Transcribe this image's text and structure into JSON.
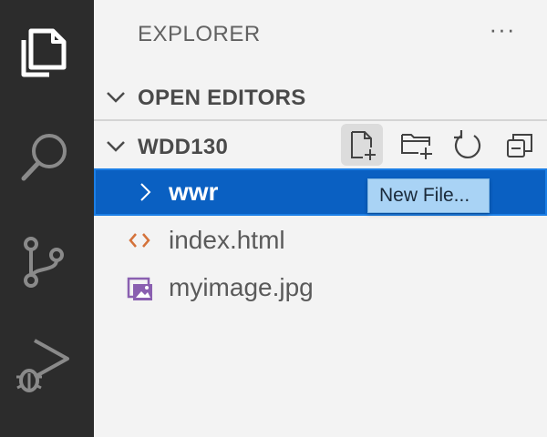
{
  "activity_bar": {
    "items": [
      {
        "icon": "files-icon"
      },
      {
        "icon": "search-icon"
      },
      {
        "icon": "source-control-icon"
      },
      {
        "icon": "run-debug-icon"
      }
    ]
  },
  "explorer": {
    "title": "EXPLORER",
    "more_label": "···",
    "open_editors_label": "OPEN EDITORS",
    "folder_label": "WDD130",
    "toolbar": [
      {
        "icon": "new-file-icon"
      },
      {
        "icon": "new-folder-icon"
      },
      {
        "icon": "refresh-icon"
      },
      {
        "icon": "collapse-all-icon"
      }
    ],
    "tooltip": "New File...",
    "tree": [
      {
        "name": "wwr",
        "type": "folder",
        "selected": true
      },
      {
        "name": "index.html",
        "type": "html-file"
      },
      {
        "name": "myimage.jpg",
        "type": "image-file"
      }
    ]
  },
  "colors": {
    "activity_bar": "#2c2c2c",
    "sidebar": "#f3f3f3",
    "selection": "#0a60c2",
    "tooltip": "#a9d3f5",
    "html_icon": "#d4723a",
    "image_icon": "#8a5fb0"
  }
}
